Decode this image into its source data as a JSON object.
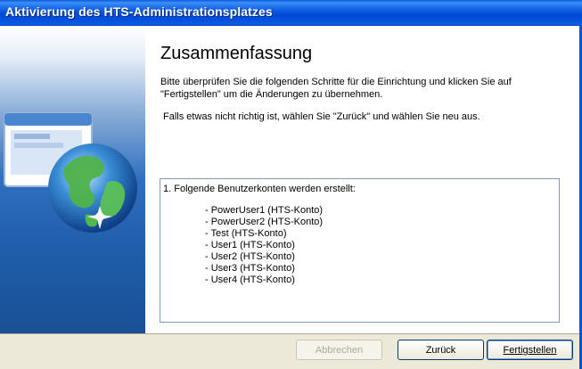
{
  "window": {
    "title": "Aktivierung des HTS-Administrationsplatzes"
  },
  "page": {
    "heading": "Zusammenfassung",
    "intro": "Bitte überprüfen Sie die folgenden Schritte für die Einrichtung und klicken Sie auf \"Fertigstellen\" um die Änderungen zu übernehmen.",
    "hint": "Falls etwas nicht richtig ist, wählen Sie \"Zurück\" und wählen Sie neu aus."
  },
  "summary": {
    "heading": "1. Folgende Benutzerkonten werden erstellt:",
    "items": [
      "- PowerUser1 (HTS-Konto)",
      "- PowerUser2 (HTS-Konto)",
      "- Test (HTS-Konto)",
      "- User1 (HTS-Konto)",
      "- User2 (HTS-Konto)",
      "- User3 (HTS-Konto)",
      "- User4 (HTS-Konto)"
    ]
  },
  "buttons": {
    "cancel": "Abbrechen",
    "back": "Zurück",
    "finish": "Fertigstellen"
  },
  "icons": {
    "sidebar": "globe-window-icon"
  },
  "colors": {
    "titlebar": "#0a58e0",
    "sidebar": "#2f6fbf",
    "footer": "#ece9d8"
  }
}
